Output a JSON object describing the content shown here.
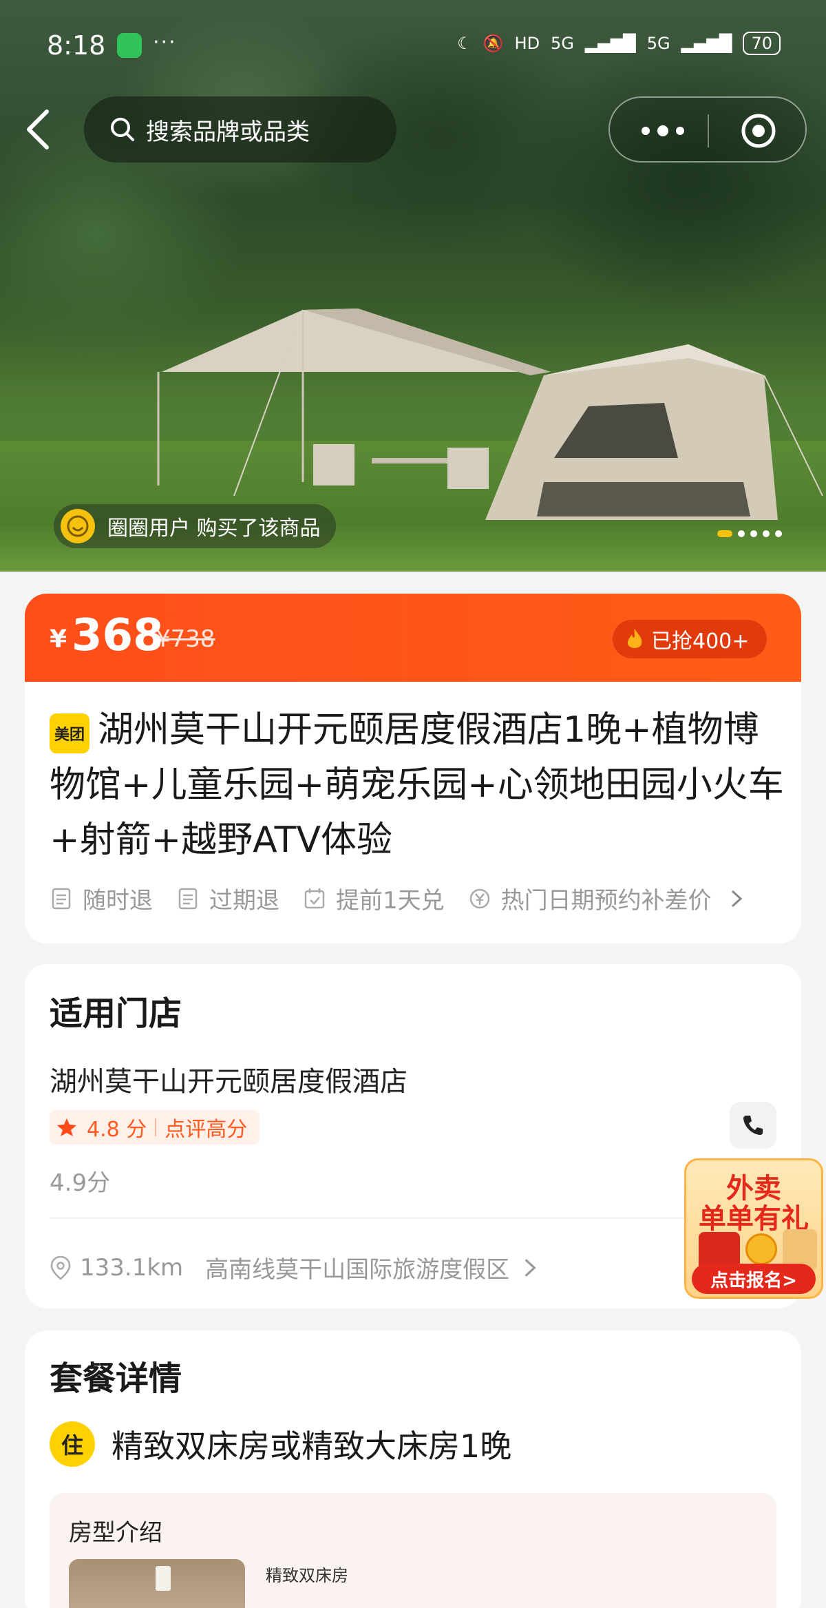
{
  "status_bar": {
    "time": "8:18",
    "battery": "70",
    "network_1": "5G",
    "network_2": "5G",
    "hd": "HD"
  },
  "nav": {
    "search_placeholder": "搜索品牌或品类"
  },
  "hero": {
    "buyer_notice": "圈圈用户 购买了该商品",
    "slides": 5,
    "active_slide": 1
  },
  "price": {
    "currency": "¥",
    "current": "368",
    "original": "¥738",
    "sold": "已抢400+"
  },
  "product": {
    "badge": "美团",
    "title": "湖州莫干山开元颐居度假酒店1晚+植物博物馆+儿童乐园+萌宠乐园+心领地田园小火车+射箭+越野ATV体验",
    "tags": [
      "随时退",
      "过期退",
      "提前1天兑",
      "热门日期预约补差价"
    ]
  },
  "store": {
    "section_title": "适用门店",
    "name": "湖州莫干山开元颐居度假酒店",
    "rating_value": "4.8 分",
    "rating_label": "点评高分",
    "score": "4.9分",
    "distance": "133.1km",
    "address": "高南线莫干山国际旅游度假区"
  },
  "promo": {
    "line1": "外卖",
    "line2": "单单有礼",
    "cta": "点击报名>"
  },
  "package": {
    "section_title": "套餐详情",
    "icon_text": "住",
    "name": "精致双床房或精致大床房1晚",
    "room_section": "房型介绍",
    "room_name": "精致双床房"
  },
  "colors": {
    "accent": "#ff5316",
    "brand_yellow": "#ffd100",
    "rating_red": "#ff5a1f"
  }
}
